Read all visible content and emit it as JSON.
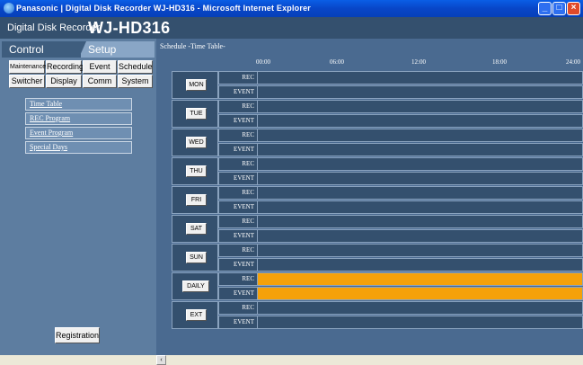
{
  "window": {
    "title": "Panasonic | Digital Disk Recorder WJ-HD316 - Microsoft Internet Explorer"
  },
  "header": {
    "brand": "Digital Disk Recorder",
    "model": "WJ-HD316"
  },
  "tabs": {
    "control": "Control",
    "setup": "Setup"
  },
  "menu_buttons": {
    "maintenance": "Maintenance",
    "recording": "Recording",
    "event": "Event",
    "schedule": "Schedule",
    "switcher": "Switcher",
    "display": "Display",
    "comm": "Comm",
    "system": "System"
  },
  "submenu": [
    "Time Table",
    "REC Program",
    "Event Program",
    "Special Days"
  ],
  "registration_label": "Registration",
  "schedule": {
    "title": "Schedule -Time Table-",
    "times": [
      "00:00",
      "06:00",
      "12:00",
      "18:00",
      "24:00"
    ],
    "row_labels": {
      "rec": "REC",
      "event": "EVENT"
    },
    "days": [
      {
        "label": "MON",
        "rec_active": false,
        "event_active": false
      },
      {
        "label": "TUE",
        "rec_active": false,
        "event_active": false
      },
      {
        "label": "WED",
        "rec_active": false,
        "event_active": false
      },
      {
        "label": "THU",
        "rec_active": false,
        "event_active": false
      },
      {
        "label": "FRI",
        "rec_active": false,
        "event_active": false
      },
      {
        "label": "SAT",
        "rec_active": false,
        "event_active": false
      },
      {
        "label": "SUN",
        "rec_active": false,
        "event_active": false
      },
      {
        "label": "DAILY",
        "rec_active": true,
        "event_active": true
      },
      {
        "label": "EXT",
        "rec_active": false,
        "event_active": false
      }
    ]
  },
  "colors": {
    "active_bar": "#f5a10a",
    "grid_bg": "#34506e",
    "panel_bg": "#4a6a90"
  }
}
